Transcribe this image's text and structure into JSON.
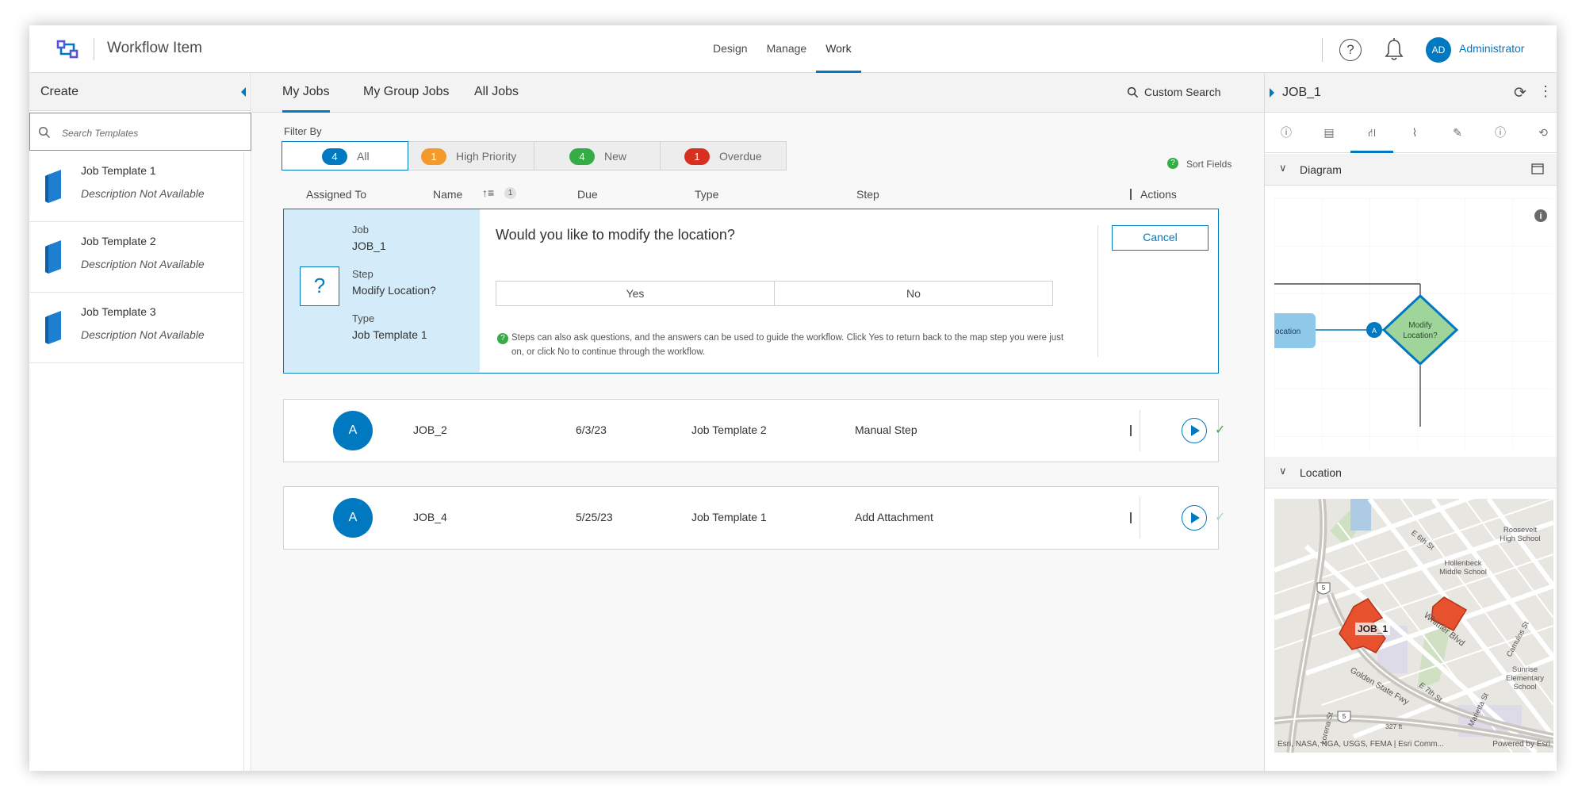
{
  "app": {
    "title": "Workflow Item"
  },
  "nav": [
    {
      "label": "Design"
    },
    {
      "label": "Manage"
    },
    {
      "label": "Work"
    }
  ],
  "user": {
    "initials": "AD",
    "name": "Administrator"
  },
  "left_panel": {
    "title": "Create",
    "search_placeholder": "Search Templates",
    "templates": [
      {
        "name": "Job Template 1",
        "description": "Description Not Available"
      },
      {
        "name": "Job Template 2",
        "description": "Description Not Available"
      },
      {
        "name": "Job Template 3",
        "description": "Description Not Available"
      }
    ]
  },
  "center": {
    "tabs": [
      {
        "label": "My Jobs"
      },
      {
        "label": "My Group Jobs"
      },
      {
        "label": "All Jobs"
      }
    ],
    "custom_search": "Custom Search",
    "filter_label": "Filter By",
    "filters": [
      {
        "count": "4",
        "label": "All",
        "color": "#0079c1"
      },
      {
        "count": "1",
        "label": "High Priority",
        "color": "#f39a2b"
      },
      {
        "count": "4",
        "label": "New",
        "color": "#35ac46"
      },
      {
        "count": "1",
        "label": "Overdue",
        "color": "#d83020"
      }
    ],
    "sort_fields": "Sort Fields",
    "columns": {
      "assigned_to": "Assigned To",
      "name": "Name",
      "sort_count": "1",
      "due": "Due",
      "type": "Type",
      "step": "Step",
      "actions": "Actions"
    },
    "expanded_job": {
      "job_label": "Job",
      "job_value": "JOB_1",
      "step_label": "Step",
      "step_value": "Modify Location?",
      "type_label": "Type",
      "type_value": "Job Template 1",
      "question": "Would you like to modify the location?",
      "yes": "Yes",
      "no": "No",
      "hint": "Steps can also ask questions, and the answers can be used to guide the workflow. Click Yes to return back to the map step you were just on, or click No to continue through the workflow.",
      "cancel": "Cancel"
    },
    "jobs": [
      {
        "assignee": "A",
        "name": "JOB_2",
        "due": "6/3/23",
        "type": "Job Template 2",
        "step": "Manual Step"
      },
      {
        "assignee": "A",
        "name": "JOB_4",
        "due": "5/25/23",
        "type": "Job Template 1",
        "step": "Add Attachment"
      }
    ]
  },
  "right_panel": {
    "title": "JOB_1",
    "diagram_title": "Diagram",
    "diagram_node_left": "ocation",
    "diagram_node_badge": "A",
    "diagram_node_decision": [
      "Modify",
      "Location?"
    ],
    "location_title": "Location",
    "map_labels": {
      "job": "JOB_1",
      "street1": "E 6th St",
      "street2": "Whittier Blvd",
      "street3": "E 7th St",
      "street4": "Golden State Fwy",
      "street5": "Camulos St",
      "street6": "Marietta St",
      "school1": [
        "Roosevelt",
        "High School"
      ],
      "school2": [
        "Hollenbeck",
        "Middle School"
      ],
      "school3": [
        "Sunrise",
        "Elementary",
        "School"
      ],
      "shield": "5",
      "shield2": "5",
      "elevation": "327 ft",
      "street7": "Lorena St"
    },
    "attribution": "Esri, NASA, NGA, USGS, FEMA | Esri Comm...",
    "powered": "Powered by Esri"
  }
}
